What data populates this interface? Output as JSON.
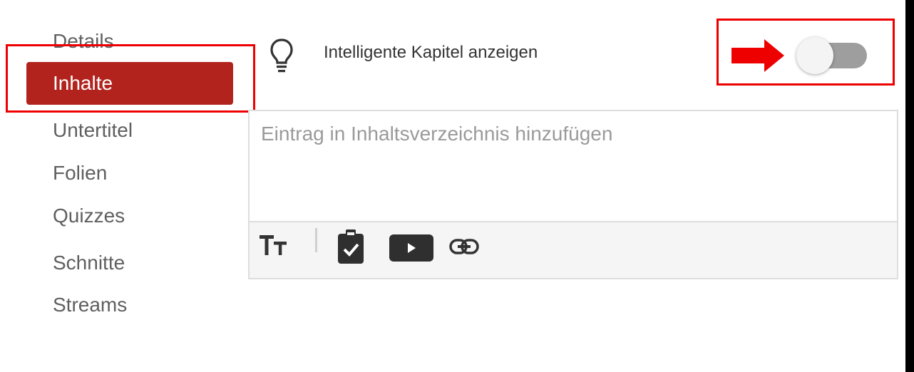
{
  "sidebar": {
    "items": [
      {
        "label": "Details"
      },
      {
        "label": "Inhalte",
        "active": true
      },
      {
        "label": "Untertitel"
      },
      {
        "label": "Folien"
      },
      {
        "label": "Quizzes"
      },
      {
        "label": "Schnitte"
      },
      {
        "label": "Streams"
      }
    ]
  },
  "header": {
    "icon": "lightbulb-icon",
    "smart_chapters_label": "Intelligente Kapitel anzeigen",
    "smart_chapters_enabled": false
  },
  "editor": {
    "placeholder": "Eintrag in Inhaltsverzeichnis hinzufügen",
    "toolbar": {
      "tools": [
        "text-size-icon",
        "quiz-check-icon",
        "video-play-icon",
        "link-icon"
      ]
    }
  },
  "colors": {
    "accent": "#b2231e",
    "annotation": "#ee0000",
    "toggle_off_track": "#9e9e9e"
  }
}
